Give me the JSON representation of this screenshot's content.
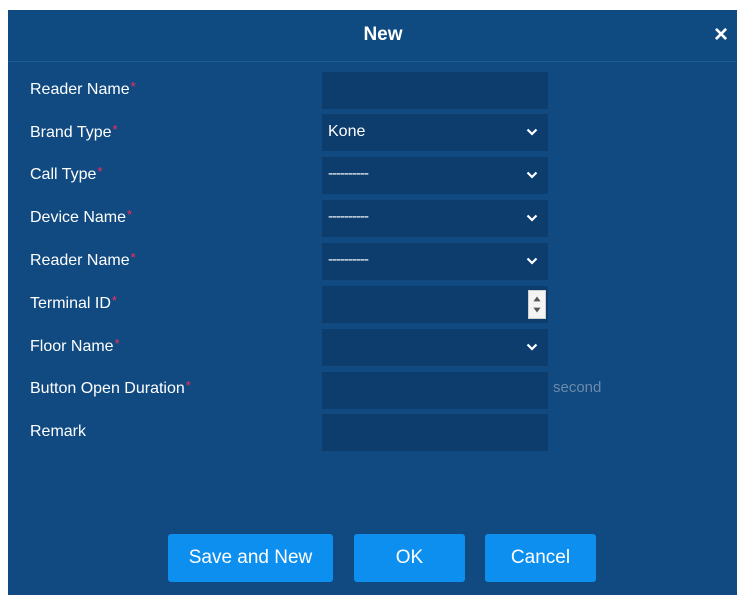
{
  "dialog": {
    "title": "New",
    "close_label": "×"
  },
  "form": {
    "fields": [
      {
        "label": "Reader Name",
        "required_mark": "*",
        "value": ""
      },
      {
        "label": "Brand Type",
        "required_mark": "*",
        "value": "Kone"
      },
      {
        "label": "Call Type",
        "required_mark": "*",
        "value": "----------"
      },
      {
        "label": "Device Name",
        "required_mark": "*",
        "value": "----------"
      },
      {
        "label": "Reader Name",
        "required_mark": "*",
        "value": "----------"
      },
      {
        "label": "Terminal ID",
        "required_mark": "*",
        "value": ""
      },
      {
        "label": "Floor Name",
        "required_mark": "*",
        "value": ""
      },
      {
        "label": "Button Open Duration",
        "required_mark": "*",
        "value": "",
        "suffix": "second"
      },
      {
        "label": "Remark",
        "value": ""
      }
    ]
  },
  "buttons": {
    "save_new": "Save and New",
    "ok": "OK",
    "cancel": "Cancel"
  },
  "icons": {
    "dropdown": "chevron-down-icon",
    "spinner": "spinner-icon",
    "close": "close-icon"
  },
  "colors": {
    "dialog_bg": "#104a81",
    "field_bg": "#0d3d6d",
    "button_bg": "#0d8ff0",
    "required": "#ff2b5b",
    "suffix_text": "#6c8aaa"
  }
}
